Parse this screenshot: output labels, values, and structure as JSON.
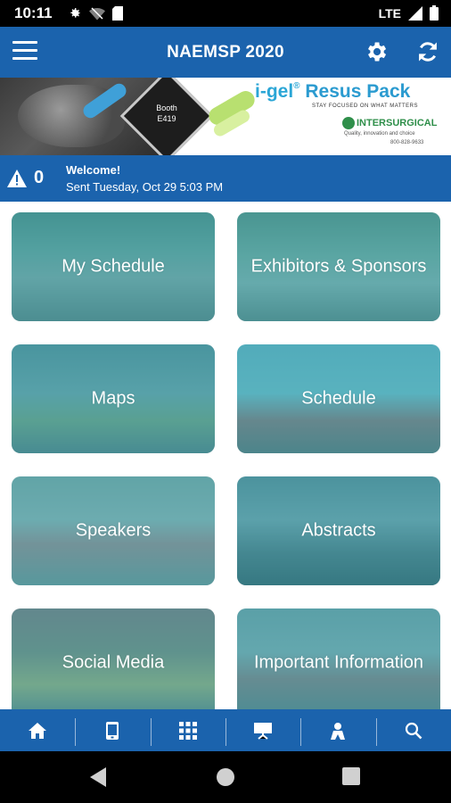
{
  "status_bar": {
    "time": "10:11",
    "network": "LTE"
  },
  "app_bar": {
    "title": "NAEMSP 2020",
    "menu_icon": "hamburger-icon",
    "settings_icon": "gear-icon",
    "refresh_icon": "refresh-icon"
  },
  "banner": {
    "booth_label": "Booth",
    "booth_number": "E419",
    "headline_brand": "i-gel",
    "headline_product": "Resus Pack",
    "tagline": "STAY FOCUSED ON WHAT MATTERS",
    "company": "INTERSURGICAL",
    "company_tagline": "Quality, innovation and choice",
    "phone": "800-828-9633"
  },
  "notification": {
    "count": "0",
    "title": "Welcome!",
    "subtitle": "Sent Tuesday, Oct 29 5:03 PM"
  },
  "tiles": [
    {
      "label": "My Schedule"
    },
    {
      "label": "Exhibitors & Sponsors"
    },
    {
      "label": "Maps"
    },
    {
      "label": "Schedule"
    },
    {
      "label": "Speakers"
    },
    {
      "label": "Abstracts"
    },
    {
      "label": "Social Media"
    },
    {
      "label": "Important Information"
    }
  ],
  "bottom_tabs": [
    {
      "icon": "home-icon"
    },
    {
      "icon": "mobile-device-icon"
    },
    {
      "icon": "grid-icon"
    },
    {
      "icon": "presentation-board-icon"
    },
    {
      "icon": "person-icon"
    },
    {
      "icon": "search-icon"
    }
  ],
  "colors": {
    "primary_blue": "#1b63ad",
    "tile_tint": "#309ba6"
  }
}
